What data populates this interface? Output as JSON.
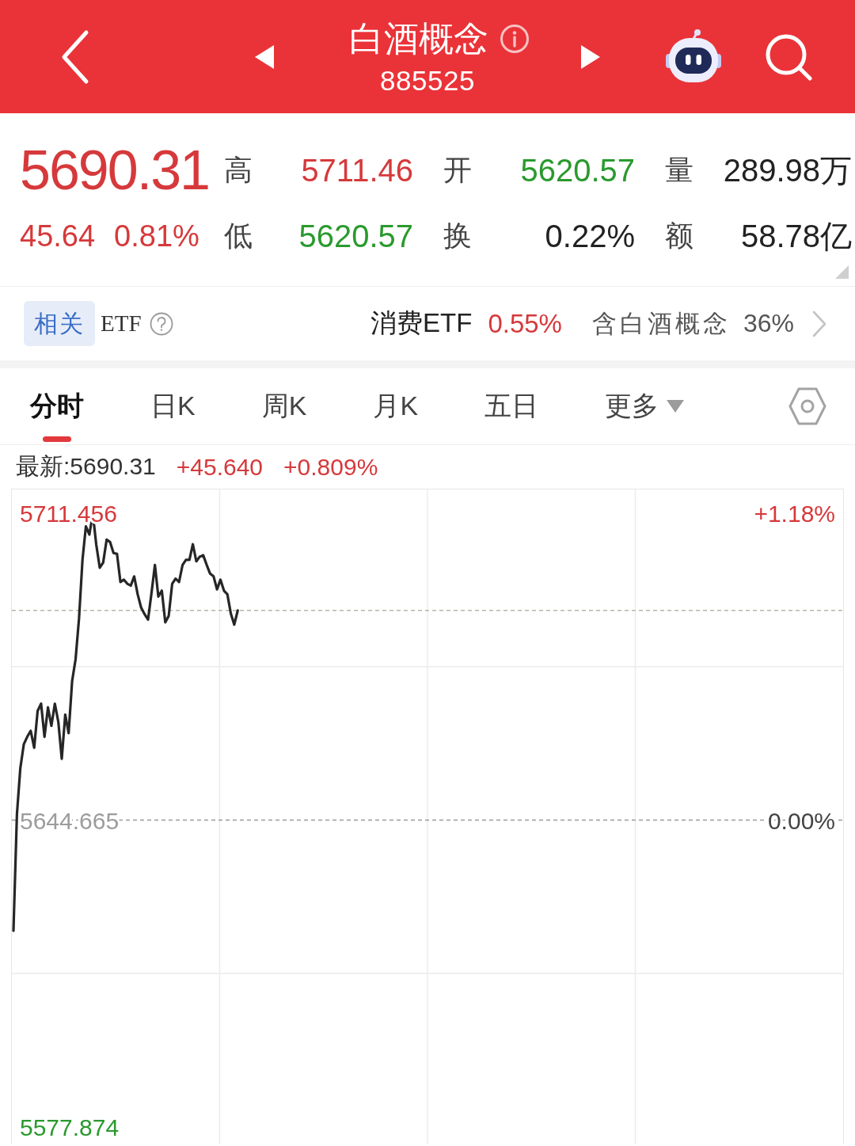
{
  "header": {
    "title": "白酒概念",
    "code": "885525"
  },
  "quote": {
    "price": "5690.31",
    "change": "45.64",
    "change_pct": "0.81%",
    "rising": true
  },
  "stats": [
    {
      "label": "高",
      "value": "5711.46",
      "color": "#d6393b"
    },
    {
      "label": "开",
      "value": "5620.57",
      "color": "#2a9a2e"
    },
    {
      "label": "量",
      "value": "289.98万",
      "color": "#222222"
    },
    {
      "label": "低",
      "value": "5620.57",
      "color": "#2a9a2e"
    },
    {
      "label": "换",
      "value": "0.22%",
      "color": "#222222"
    },
    {
      "label": "额",
      "value": "58.78亿",
      "color": "#222222"
    }
  ],
  "etf": {
    "badge": "相关",
    "label": "ETF",
    "name": "消费ETF",
    "change": "0.55%",
    "rising": true,
    "holding_label": "含白酒概念",
    "holding": "36%"
  },
  "tabs": [
    {
      "label": "分时",
      "selected": true,
      "kind": "view"
    },
    {
      "label": "日K",
      "selected": false,
      "kind": "view"
    },
    {
      "label": "周K",
      "selected": false,
      "kind": "view"
    },
    {
      "label": "月K",
      "selected": false,
      "kind": "view"
    },
    {
      "label": "五日",
      "selected": false,
      "kind": "view"
    },
    {
      "label": "更多",
      "selected": false,
      "kind": "dropdown"
    }
  ],
  "info_line": {
    "latest": "最新:5690.31",
    "change": "+45.640",
    "change_pct": "+0.809%",
    "rising": true
  },
  "chart": {
    "right_labels": [
      "+1.18%",
      "0.00%"
    ],
    "chart_data": {
      "type": "line",
      "ylim": [
        5574.08,
        5716.63
      ],
      "yticks": [
        5711.456,
        5644.665,
        5577.874
      ],
      "ref_lines": [
        {
          "axis": "y",
          "value": 5644.665,
          "color": "#9a9a9a"
        },
        {
          "axis": "y",
          "value": 5690.31,
          "color": "#b3b9a6"
        }
      ],
      "categories": [
        null,
        null,
        null,
        null,
        null,
        null,
        null,
        null,
        null,
        null,
        null,
        null,
        null,
        null,
        null,
        null,
        null,
        null,
        null,
        null,
        null,
        null,
        null,
        null,
        null,
        null,
        null,
        null,
        null,
        null,
        null,
        null,
        null,
        null,
        null,
        null,
        null,
        null,
        null,
        null,
        null,
        null,
        null,
        null,
        null,
        null,
        null,
        null,
        null,
        null,
        null,
        null,
        null,
        null,
        null,
        null,
        null,
        null,
        null,
        null,
        null,
        null,
        null,
        null,
        null,
        null,
        null,
        null,
        null,
        null,
        null,
        null,
        null,
        null,
        null,
        null,
        null,
        null,
        null,
        null,
        null,
        null,
        null,
        null,
        null,
        null,
        null,
        null,
        null,
        null,
        null,
        null,
        null,
        null,
        null,
        null,
        null,
        null,
        null,
        null,
        null,
        null,
        null,
        null,
        null,
        null,
        null,
        null,
        null,
        null,
        null,
        null,
        null,
        null,
        null,
        null,
        null,
        null,
        null,
        null,
        null,
        null,
        null,
        null,
        null,
        null,
        null,
        null,
        null,
        null,
        null,
        null,
        null,
        null,
        null,
        null,
        null,
        null,
        null,
        null,
        null,
        null,
        null,
        null,
        null,
        null,
        null,
        null,
        null,
        null,
        null,
        null,
        null,
        null,
        null,
        null,
        null,
        null,
        null,
        null,
        null,
        null,
        null,
        null,
        null,
        null,
        null,
        null,
        null,
        null,
        null,
        null,
        null,
        null,
        null,
        null,
        null,
        null,
        null,
        null,
        null,
        null,
        null,
        null,
        null,
        null,
        null,
        null,
        null,
        null,
        null,
        null,
        null,
        null,
        null,
        null,
        null,
        null,
        null,
        null,
        null,
        null,
        null,
        null,
        null,
        null,
        null,
        null,
        null,
        null,
        null,
        null,
        null,
        null,
        null,
        null,
        null,
        null,
        null,
        null,
        null,
        null,
        null,
        null,
        null,
        null,
        null,
        null,
        null,
        null,
        null,
        null,
        null,
        null,
        null,
        null,
        null,
        null,
        null,
        null,
        null
      ],
      "values": [
        5620.6,
        5646.0,
        5656.0,
        5661.2,
        5662.8,
        5664.1,
        5660.4,
        5668.4,
        5670.0,
        5662.8,
        5669.2,
        5665.2,
        5670.0,
        5666.0,
        5658.0,
        5667.6,
        5663.6,
        5674.9,
        5679.7,
        5688.5,
        5701.3,
        5708.6,
        5706.8,
        5711.4,
        5704.6,
        5699.6,
        5700.7,
        5705.7,
        5705.2,
        5702.8,
        5702.6,
        5696.5,
        5697.0,
        5696.1,
        5695.7,
        5697.7,
        5693.8,
        5690.9,
        5689.5,
        5688.3,
        5694.0,
        5700.2,
        5693.3,
        5694.6,
        5687.7,
        5689.1,
        5696.1,
        5697.2,
        5696.5,
        5700.2,
        5701.3,
        5701.3,
        5704.7,
        5701.0,
        5702.0,
        5702.3,
        5700.2,
        5698.3,
        5697.7,
        5694.9,
        5697.0,
        5694.6,
        5693.8,
        5689.6,
        5687.2,
        5690.3,
        null,
        null,
        null,
        null,
        null,
        null,
        null,
        null,
        null,
        null,
        null,
        null,
        null,
        null,
        null,
        null,
        null,
        null,
        null,
        null,
        null,
        null,
        null,
        null,
        null,
        null,
        null,
        null,
        null,
        null,
        null,
        null,
        null,
        null,
        null,
        null,
        null,
        null,
        null,
        null,
        null,
        null,
        null,
        null,
        null,
        null,
        null,
        null,
        null,
        null,
        null,
        null,
        null,
        null,
        null,
        null,
        null,
        null,
        null,
        null,
        null,
        null,
        null,
        null,
        null,
        null,
        null,
        null,
        null,
        null,
        null,
        null,
        null,
        null,
        null,
        null,
        null,
        null,
        null,
        null,
        null,
        null,
        null,
        null,
        null,
        null,
        null,
        null,
        null,
        null,
        null,
        null,
        null,
        null,
        null,
        null,
        null,
        null,
        null,
        null,
        null,
        null,
        null,
        null,
        null,
        null,
        null,
        null,
        null,
        null,
        null,
        null,
        null,
        null,
        null,
        null,
        null,
        null,
        null,
        null,
        null,
        null,
        null,
        null,
        null,
        null,
        null,
        null,
        null,
        null,
        null,
        null,
        null,
        null,
        null,
        null,
        null,
        null,
        null,
        null,
        null,
        null,
        null,
        null,
        null,
        null,
        null,
        null,
        null,
        null,
        null,
        null,
        null,
        null,
        null,
        null,
        null,
        null,
        null,
        null,
        null,
        null,
        null,
        null,
        null,
        null,
        null,
        null,
        null,
        null,
        null,
        null,
        null,
        null,
        null
      ]
    }
  }
}
